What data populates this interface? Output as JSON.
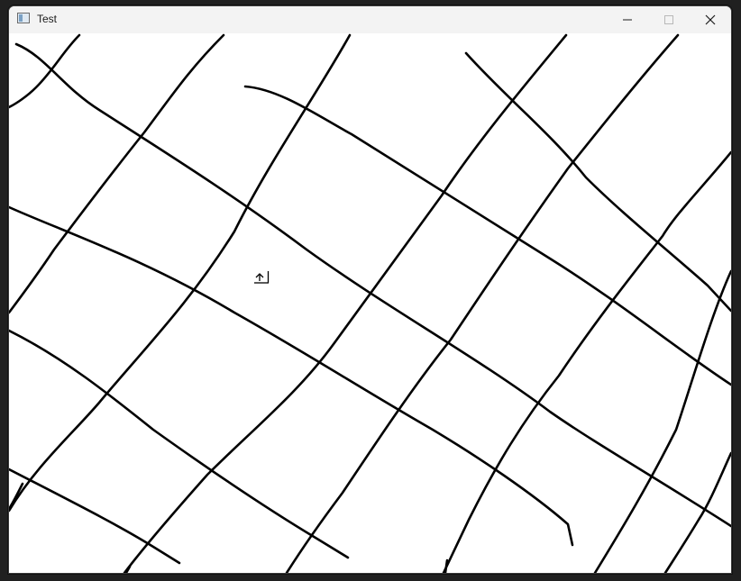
{
  "window": {
    "title": "Test",
    "icons": {
      "app": "app-window-icon",
      "minimize": "minimize-icon",
      "maximize": "maximize-icon",
      "close": "close-icon",
      "cursor": "up-arrow-cursor-icon"
    }
  },
  "canvas": {
    "background": "#ffffff",
    "stroke_color": "#000000",
    "stroke_count": 18
  }
}
